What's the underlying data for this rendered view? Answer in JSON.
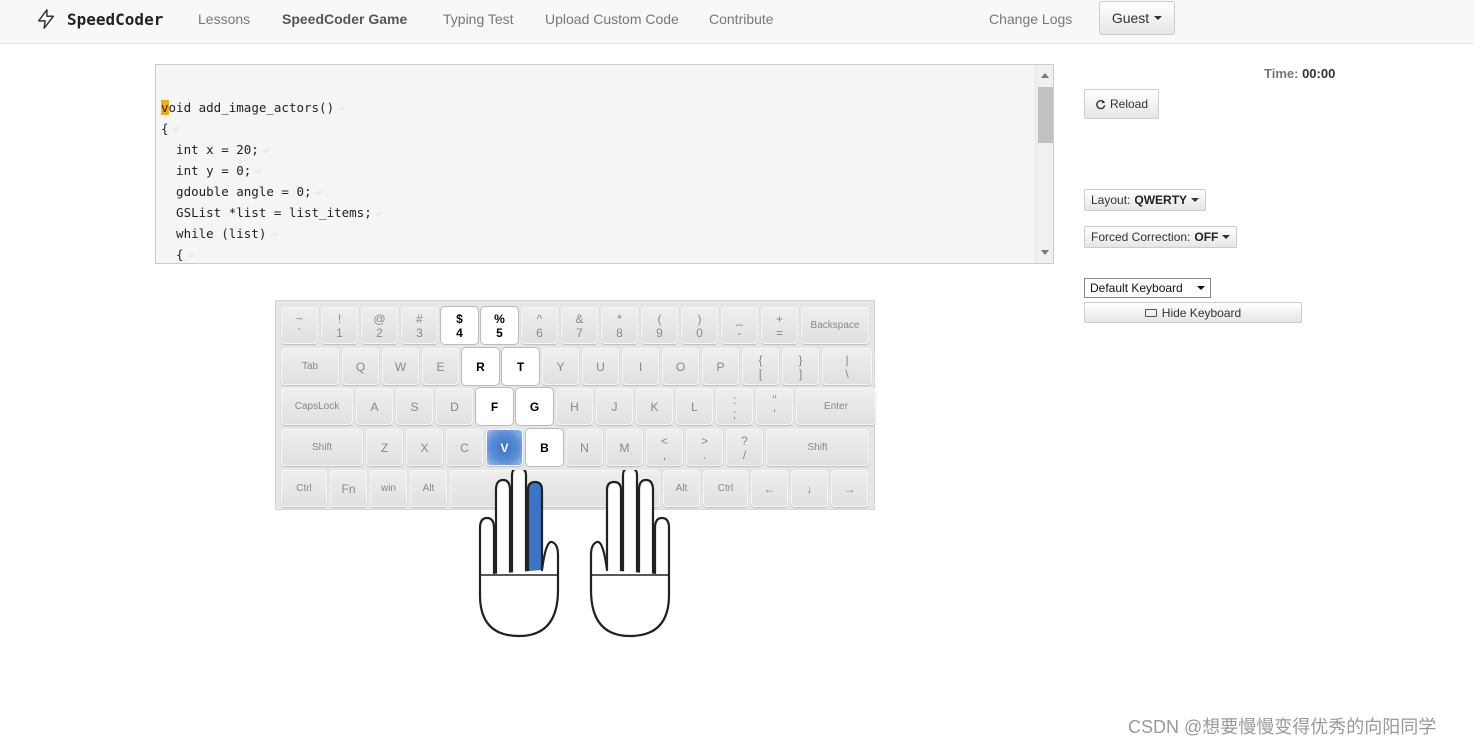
{
  "navbar": {
    "brand": "SpeedCoder",
    "links": [
      "Lessons",
      "SpeedCoder Game",
      "Typing Test",
      "Upload Custom Code",
      "Contribute"
    ],
    "change_logs": "Change Logs",
    "user_menu": "Guest"
  },
  "code": {
    "lines": [
      "void add_image_actors()",
      "{",
      "  int x = 20;",
      "  int y = 0;",
      "  gdouble angle = 0;",
      "  GSList *list = list_items;",
      "  while (list)",
      "  {"
    ],
    "cursor_char": "v",
    "first_line_rest": "oid add_image_actors()",
    "eol_mark": "⏎"
  },
  "controls": {
    "time_label": "Time:",
    "time_value": "00:00",
    "reload_label": "Reload",
    "layout_label": "Layout:",
    "layout_value": "QWERTY",
    "correction_label": "Forced Correction:",
    "correction_value": "OFF",
    "keyboard_select": "Default Keyboard",
    "hide_keyboard_label": "Hide Keyboard"
  },
  "keyboard": {
    "highlight_color": "#3b73c6",
    "rows": [
      [
        [
          "~",
          "`"
        ],
        [
          "!",
          "1"
        ],
        [
          "@",
          "2"
        ],
        [
          "#",
          "3"
        ],
        [
          "$",
          "4"
        ],
        [
          "%",
          "5"
        ],
        [
          "^",
          "6"
        ],
        [
          "&",
          "7"
        ],
        [
          "*",
          "8"
        ],
        [
          "(",
          "9"
        ],
        [
          ")",
          "0"
        ],
        [
          "_",
          "-"
        ],
        [
          "+",
          "="
        ],
        [
          "Backspace"
        ]
      ],
      [
        [
          "Tab"
        ],
        [
          "Q"
        ],
        [
          "W"
        ],
        [
          "E"
        ],
        [
          "R"
        ],
        [
          "T"
        ],
        [
          "Y"
        ],
        [
          "U"
        ],
        [
          "I"
        ],
        [
          "O"
        ],
        [
          "P"
        ],
        [
          "{",
          "["
        ],
        [
          "}",
          "]"
        ],
        [
          "|",
          "\\"
        ]
      ],
      [
        [
          "CapsLock"
        ],
        [
          "A"
        ],
        [
          "S"
        ],
        [
          "D"
        ],
        [
          "F"
        ],
        [
          "G"
        ],
        [
          "H"
        ],
        [
          "J"
        ],
        [
          "K"
        ],
        [
          "L"
        ],
        [
          ":",
          ";"
        ],
        [
          "\"",
          "'"
        ],
        [
          "Enter"
        ]
      ],
      [
        [
          "Shift"
        ],
        [
          "Z"
        ],
        [
          "X"
        ],
        [
          "C"
        ],
        [
          "V"
        ],
        [
          "B"
        ],
        [
          "N"
        ],
        [
          "M"
        ],
        [
          "<",
          ","
        ],
        [
          ">",
          "."
        ],
        [
          "?",
          "/"
        ],
        [
          "Shift"
        ]
      ],
      [
        [
          "Ctrl"
        ],
        [
          "Fn"
        ],
        [
          "win"
        ],
        [
          "Alt"
        ],
        [
          ""
        ],
        [
          "Alt"
        ],
        [
          "Ctrl"
        ],
        [
          "←"
        ],
        [
          "↓"
        ],
        [
          "→"
        ]
      ]
    ],
    "highlighted_keys": [
      "$4",
      "%5",
      "R",
      "T",
      "F",
      "G",
      "B"
    ],
    "target_key": "V"
  },
  "hands": {
    "active_finger": "left-index",
    "finger_color": "#3b73c6"
  },
  "watermark": "CSDN @想要慢慢变得优秀的向阳同学"
}
